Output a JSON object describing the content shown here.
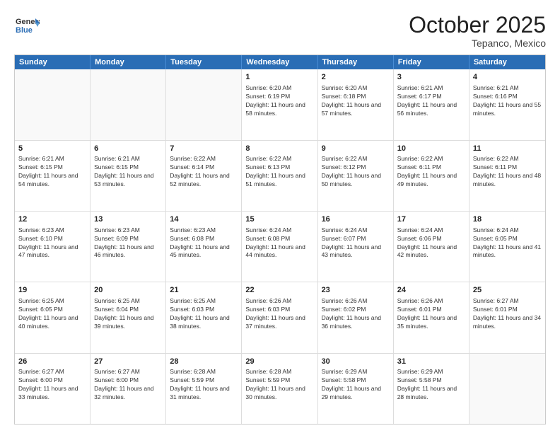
{
  "header": {
    "logo": {
      "general": "General",
      "blue": "Blue"
    },
    "title": "October 2025",
    "location": "Tepanco, Mexico"
  },
  "days_of_week": [
    "Sunday",
    "Monday",
    "Tuesday",
    "Wednesday",
    "Thursday",
    "Friday",
    "Saturday"
  ],
  "weeks": [
    [
      {
        "day": "",
        "sunrise": "",
        "sunset": "",
        "daylight": ""
      },
      {
        "day": "",
        "sunrise": "",
        "sunset": "",
        "daylight": ""
      },
      {
        "day": "",
        "sunrise": "",
        "sunset": "",
        "daylight": ""
      },
      {
        "day": "1",
        "sunrise": "Sunrise: 6:20 AM",
        "sunset": "Sunset: 6:19 PM",
        "daylight": "Daylight: 11 hours and 58 minutes."
      },
      {
        "day": "2",
        "sunrise": "Sunrise: 6:20 AM",
        "sunset": "Sunset: 6:18 PM",
        "daylight": "Daylight: 11 hours and 57 minutes."
      },
      {
        "day": "3",
        "sunrise": "Sunrise: 6:21 AM",
        "sunset": "Sunset: 6:17 PM",
        "daylight": "Daylight: 11 hours and 56 minutes."
      },
      {
        "day": "4",
        "sunrise": "Sunrise: 6:21 AM",
        "sunset": "Sunset: 6:16 PM",
        "daylight": "Daylight: 11 hours and 55 minutes."
      }
    ],
    [
      {
        "day": "5",
        "sunrise": "Sunrise: 6:21 AM",
        "sunset": "Sunset: 6:15 PM",
        "daylight": "Daylight: 11 hours and 54 minutes."
      },
      {
        "day": "6",
        "sunrise": "Sunrise: 6:21 AM",
        "sunset": "Sunset: 6:15 PM",
        "daylight": "Daylight: 11 hours and 53 minutes."
      },
      {
        "day": "7",
        "sunrise": "Sunrise: 6:22 AM",
        "sunset": "Sunset: 6:14 PM",
        "daylight": "Daylight: 11 hours and 52 minutes."
      },
      {
        "day": "8",
        "sunrise": "Sunrise: 6:22 AM",
        "sunset": "Sunset: 6:13 PM",
        "daylight": "Daylight: 11 hours and 51 minutes."
      },
      {
        "day": "9",
        "sunrise": "Sunrise: 6:22 AM",
        "sunset": "Sunset: 6:12 PM",
        "daylight": "Daylight: 11 hours and 50 minutes."
      },
      {
        "day": "10",
        "sunrise": "Sunrise: 6:22 AM",
        "sunset": "Sunset: 6:11 PM",
        "daylight": "Daylight: 11 hours and 49 minutes."
      },
      {
        "day": "11",
        "sunrise": "Sunrise: 6:22 AM",
        "sunset": "Sunset: 6:11 PM",
        "daylight": "Daylight: 11 hours and 48 minutes."
      }
    ],
    [
      {
        "day": "12",
        "sunrise": "Sunrise: 6:23 AM",
        "sunset": "Sunset: 6:10 PM",
        "daylight": "Daylight: 11 hours and 47 minutes."
      },
      {
        "day": "13",
        "sunrise": "Sunrise: 6:23 AM",
        "sunset": "Sunset: 6:09 PM",
        "daylight": "Daylight: 11 hours and 46 minutes."
      },
      {
        "day": "14",
        "sunrise": "Sunrise: 6:23 AM",
        "sunset": "Sunset: 6:08 PM",
        "daylight": "Daylight: 11 hours and 45 minutes."
      },
      {
        "day": "15",
        "sunrise": "Sunrise: 6:24 AM",
        "sunset": "Sunset: 6:08 PM",
        "daylight": "Daylight: 11 hours and 44 minutes."
      },
      {
        "day": "16",
        "sunrise": "Sunrise: 6:24 AM",
        "sunset": "Sunset: 6:07 PM",
        "daylight": "Daylight: 11 hours and 43 minutes."
      },
      {
        "day": "17",
        "sunrise": "Sunrise: 6:24 AM",
        "sunset": "Sunset: 6:06 PM",
        "daylight": "Daylight: 11 hours and 42 minutes."
      },
      {
        "day": "18",
        "sunrise": "Sunrise: 6:24 AM",
        "sunset": "Sunset: 6:05 PM",
        "daylight": "Daylight: 11 hours and 41 minutes."
      }
    ],
    [
      {
        "day": "19",
        "sunrise": "Sunrise: 6:25 AM",
        "sunset": "Sunset: 6:05 PM",
        "daylight": "Daylight: 11 hours and 40 minutes."
      },
      {
        "day": "20",
        "sunrise": "Sunrise: 6:25 AM",
        "sunset": "Sunset: 6:04 PM",
        "daylight": "Daylight: 11 hours and 39 minutes."
      },
      {
        "day": "21",
        "sunrise": "Sunrise: 6:25 AM",
        "sunset": "Sunset: 6:03 PM",
        "daylight": "Daylight: 11 hours and 38 minutes."
      },
      {
        "day": "22",
        "sunrise": "Sunrise: 6:26 AM",
        "sunset": "Sunset: 6:03 PM",
        "daylight": "Daylight: 11 hours and 37 minutes."
      },
      {
        "day": "23",
        "sunrise": "Sunrise: 6:26 AM",
        "sunset": "Sunset: 6:02 PM",
        "daylight": "Daylight: 11 hours and 36 minutes."
      },
      {
        "day": "24",
        "sunrise": "Sunrise: 6:26 AM",
        "sunset": "Sunset: 6:01 PM",
        "daylight": "Daylight: 11 hours and 35 minutes."
      },
      {
        "day": "25",
        "sunrise": "Sunrise: 6:27 AM",
        "sunset": "Sunset: 6:01 PM",
        "daylight": "Daylight: 11 hours and 34 minutes."
      }
    ],
    [
      {
        "day": "26",
        "sunrise": "Sunrise: 6:27 AM",
        "sunset": "Sunset: 6:00 PM",
        "daylight": "Daylight: 11 hours and 33 minutes."
      },
      {
        "day": "27",
        "sunrise": "Sunrise: 6:27 AM",
        "sunset": "Sunset: 6:00 PM",
        "daylight": "Daylight: 11 hours and 32 minutes."
      },
      {
        "day": "28",
        "sunrise": "Sunrise: 6:28 AM",
        "sunset": "Sunset: 5:59 PM",
        "daylight": "Daylight: 11 hours and 31 minutes."
      },
      {
        "day": "29",
        "sunrise": "Sunrise: 6:28 AM",
        "sunset": "Sunset: 5:59 PM",
        "daylight": "Daylight: 11 hours and 30 minutes."
      },
      {
        "day": "30",
        "sunrise": "Sunrise: 6:29 AM",
        "sunset": "Sunset: 5:58 PM",
        "daylight": "Daylight: 11 hours and 29 minutes."
      },
      {
        "day": "31",
        "sunrise": "Sunrise: 6:29 AM",
        "sunset": "Sunset: 5:58 PM",
        "daylight": "Daylight: 11 hours and 28 minutes."
      },
      {
        "day": "",
        "sunrise": "",
        "sunset": "",
        "daylight": ""
      }
    ]
  ]
}
